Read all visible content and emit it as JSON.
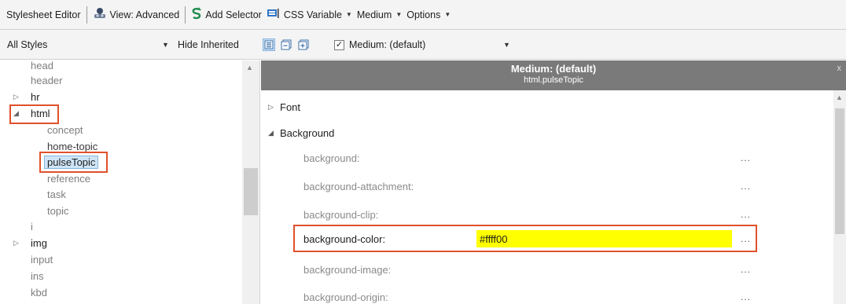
{
  "toolbar1": {
    "stylesheet_editor": "Stylesheet Editor",
    "view_label": "View: Advanced",
    "add_selector": "Add Selector",
    "css_variable": "CSS Variable",
    "medium": "Medium",
    "options": "Options"
  },
  "toolbar2": {
    "filter_value": "All Styles",
    "hide_inherited": "Hide Inherited",
    "medium_checked": true,
    "medium_value": "Medium: (default)"
  },
  "tree": {
    "items": [
      {
        "label": "head"
      },
      {
        "label": "header"
      },
      {
        "label": "hr"
      },
      {
        "label": "html"
      },
      {
        "label": "concept"
      },
      {
        "label": "home-topic"
      },
      {
        "label": "pulseTopic"
      },
      {
        "label": "reference"
      },
      {
        "label": "task"
      },
      {
        "label": "topic"
      },
      {
        "label": "i"
      },
      {
        "label": "img"
      },
      {
        "label": "input"
      },
      {
        "label": "ins"
      },
      {
        "label": "kbd"
      }
    ]
  },
  "panel": {
    "medium_title": "Medium: (default)",
    "selector": "html.pulseTopic",
    "close_glyph": "x",
    "sections": {
      "font": "Font",
      "background": "Background"
    },
    "properties": [
      {
        "name": "background:",
        "value": "",
        "dots": "..."
      },
      {
        "name": "background-attachment:",
        "value": "",
        "dots": "..."
      },
      {
        "name": "background-clip:",
        "value": "",
        "dots": "..."
      },
      {
        "name": "background-color:",
        "value": "#ffff00",
        "dots": "..."
      },
      {
        "name": "background-image:",
        "value": "",
        "dots": "..."
      },
      {
        "name": "background-origin:",
        "value": "",
        "dots": "..."
      }
    ]
  },
  "colors": {
    "highlight_border": "#e0512b",
    "panel_header": "#7a7a7a",
    "value_fill": "#ffff00",
    "selection": "#cfe5f7"
  }
}
